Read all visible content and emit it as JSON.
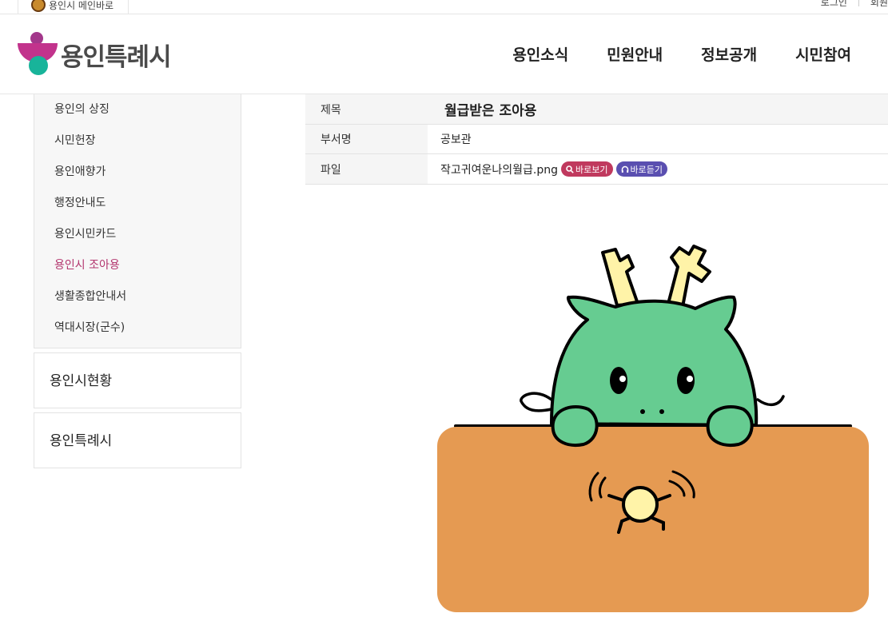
{
  "utility": {
    "site_label": "용인시 메인바로",
    "login_label": "로그인",
    "join_label": "회원"
  },
  "header": {
    "logo_text": "용인특례시",
    "nav": [
      "용인소식",
      "민원안내",
      "정보공개",
      "시민참여"
    ]
  },
  "sidebar": {
    "submenu": [
      "용인의 상징",
      "시민헌장",
      "용인애향가",
      "행정안내도",
      "용인시민카드",
      "용인시 조아용",
      "생활종합안내서",
      "역대시장(군수)"
    ],
    "active_index": 5,
    "boxes": [
      "용인시현황",
      "용인특례시"
    ]
  },
  "detail": {
    "title_label": "제목",
    "title_value": "월급받은 조아용",
    "dept_label": "부서명",
    "dept_value": "공보관",
    "file_label": "파일",
    "file_name": "작고귀여운나의월급.png",
    "view_button": "바로보기",
    "listen_button": "바로듣기"
  },
  "colors": {
    "accent": "#b3366e",
    "dragon": "#66cc91",
    "desk": "#e59a52",
    "horn": "#fff3a8"
  }
}
